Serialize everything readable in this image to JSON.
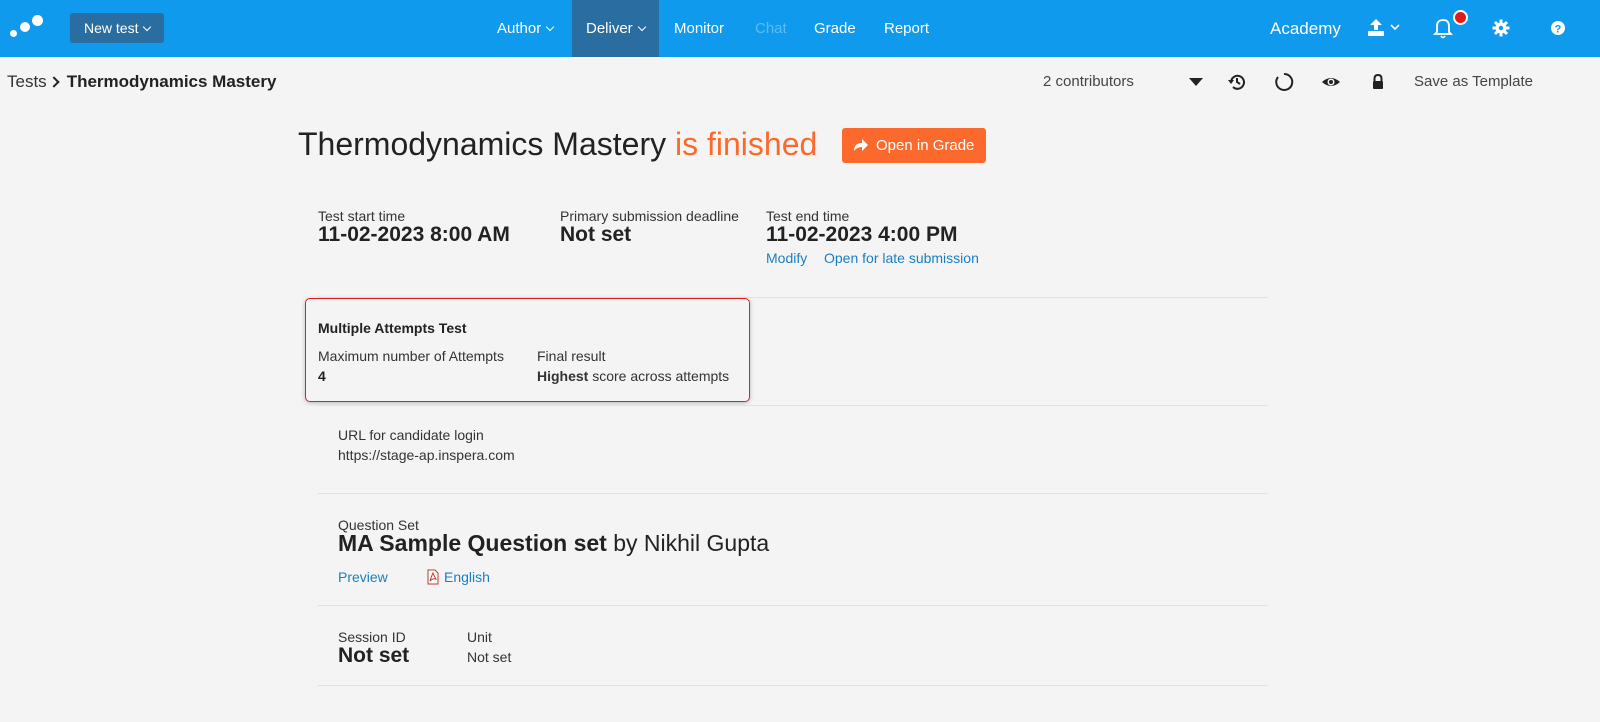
{
  "nav": {
    "new_test": "New test",
    "author": "Author",
    "deliver": "Deliver",
    "monitor": "Monitor",
    "chat": "Chat",
    "grade": "Grade",
    "report": "Report",
    "academy": "Academy"
  },
  "breadcrumb": {
    "root": "Tests",
    "current": "Thermodynamics Mastery"
  },
  "toolbar": {
    "contributors": "2 contributors",
    "save_template": "Save as Template"
  },
  "header": {
    "test_name": "Thermodynamics Mastery",
    "status": "is finished",
    "open_grade": "Open in Grade"
  },
  "times": {
    "start_label": "Test start time",
    "start_value": "11-02-2023 8:00 AM",
    "deadline_label": "Primary submission deadline",
    "deadline_value": "Not set",
    "end_label": "Test end time",
    "end_value": "11-02-2023 4:00 PM",
    "modify": "Modify",
    "late": "Open for late submission"
  },
  "attempts": {
    "title": "Multiple Attempts Test",
    "max_label": "Maximum number of Attempts",
    "max_value": "4",
    "final_label": "Final result",
    "final_bold": "Highest",
    "final_rest": "score across attempts"
  },
  "login": {
    "label": "URL for candidate login",
    "url": "https://stage-ap.inspera.com"
  },
  "question_set": {
    "label": "Question Set",
    "name": "MA Sample Question set",
    "by": "by Nikhil Gupta",
    "preview": "Preview",
    "language": "English"
  },
  "session": {
    "id_label": "Session ID",
    "id_value": "Not set",
    "unit_label": "Unit",
    "unit_value": "Not set"
  },
  "colors": {
    "nav_bg": "#0f9aee",
    "accent": "#fb6a2c",
    "link": "#1a7fc3",
    "highlight": "#e02020"
  }
}
